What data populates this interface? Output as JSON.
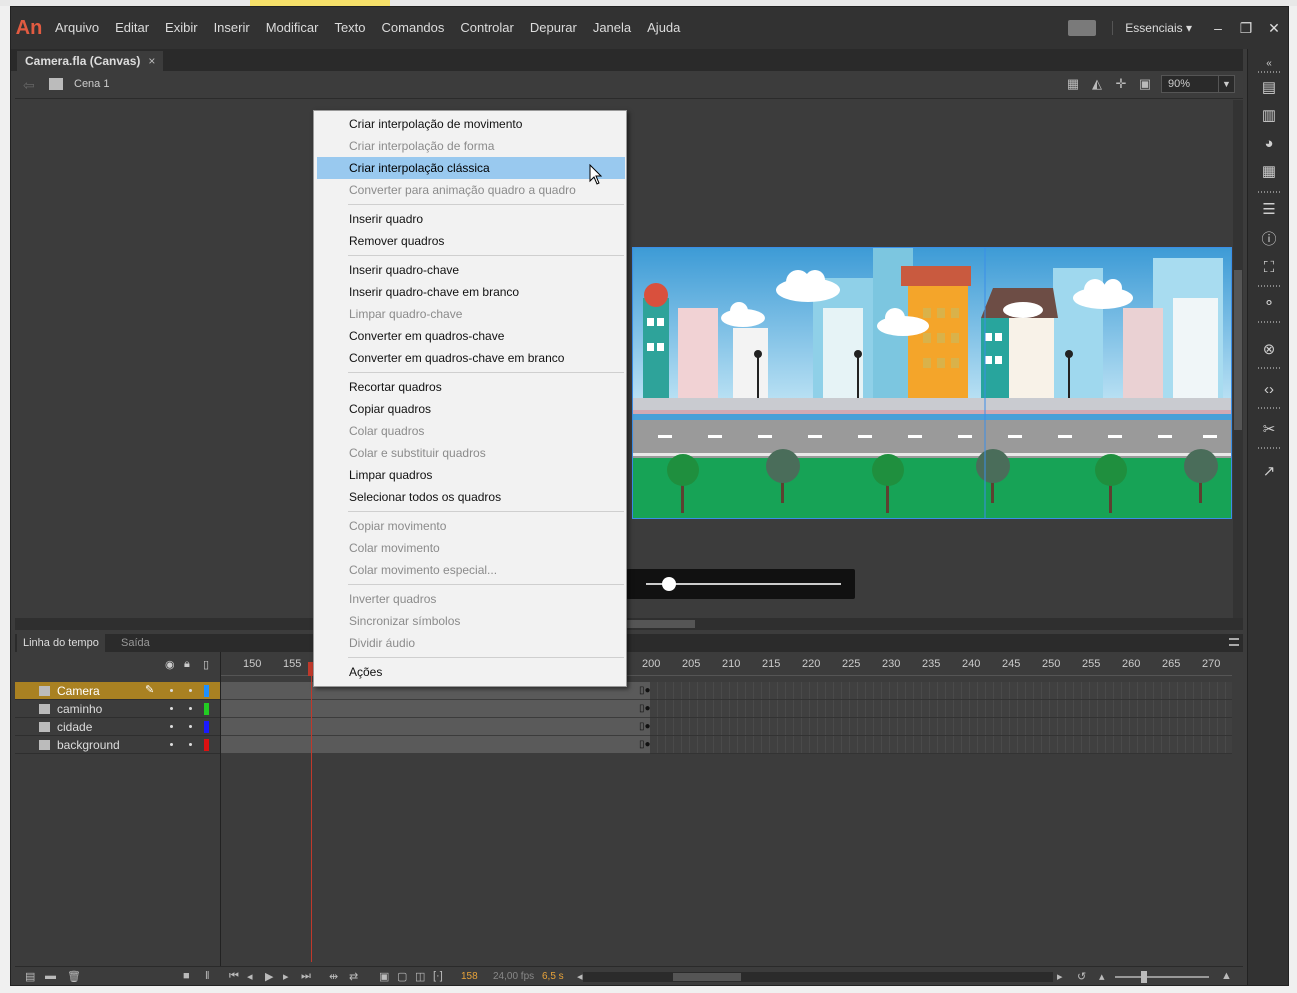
{
  "app": {
    "logo": "An",
    "menu": [
      "Arquivo",
      "Editar",
      "Exibir",
      "Inserir",
      "Modificar",
      "Texto",
      "Comandos",
      "Controlar",
      "Depurar",
      "Janela",
      "Ajuda"
    ],
    "workspace": "Essenciais",
    "window_controls": [
      "–",
      "❐",
      "✕"
    ]
  },
  "document": {
    "tab_title": "Camera.fla (Canvas)",
    "tab_close": "×",
    "scene_label": "Cena 1",
    "zoom": "90%"
  },
  "context_menu": {
    "items": [
      {
        "label": "Criar interpolação de movimento",
        "enabled": true
      },
      {
        "label": "Criar interpolação de forma",
        "enabled": false
      },
      {
        "label": "Criar interpolação clássica",
        "enabled": true,
        "highlighted": true
      },
      {
        "label": "Converter para animação quadro a quadro",
        "enabled": false
      },
      {
        "label": "Inserir quadro",
        "enabled": true
      },
      {
        "label": "Remover quadros",
        "enabled": true
      },
      {
        "label": "Inserir quadro-chave",
        "enabled": true
      },
      {
        "label": "Inserir quadro-chave em branco",
        "enabled": true
      },
      {
        "label": "Limpar quadro-chave",
        "enabled": false
      },
      {
        "label": "Converter em quadros-chave",
        "enabled": true
      },
      {
        "label": "Converter em quadros-chave em branco",
        "enabled": true
      },
      {
        "label": "Recortar quadros",
        "enabled": true
      },
      {
        "label": "Copiar quadros",
        "enabled": true
      },
      {
        "label": "Colar quadros",
        "enabled": false
      },
      {
        "label": "Colar e substituir quadros",
        "enabled": false
      },
      {
        "label": "Limpar quadros",
        "enabled": true
      },
      {
        "label": "Selecionar todos os quadros",
        "enabled": true
      },
      {
        "label": "Copiar movimento",
        "enabled": false
      },
      {
        "label": "Colar movimento",
        "enabled": false
      },
      {
        "label": "Colar movimento especial...",
        "enabled": false
      },
      {
        "label": "Inverter quadros",
        "enabled": false
      },
      {
        "label": "Sincronizar símbolos",
        "enabled": false
      },
      {
        "label": "Dividir áudio",
        "enabled": false
      },
      {
        "label": "Ações",
        "enabled": true
      }
    ]
  },
  "timeline": {
    "tabs": [
      "Linha do tempo",
      "Saída"
    ],
    "ruler": [
      "150",
      "155",
      "200",
      "205",
      "210",
      "215",
      "220",
      "225",
      "230",
      "235",
      "240",
      "245",
      "250",
      "255",
      "260",
      "265",
      "270"
    ],
    "layers": [
      {
        "name": "Camera",
        "color": "#1e90ff",
        "selected": true
      },
      {
        "name": "caminho",
        "color": "#22cc22",
        "selected": false
      },
      {
        "name": "cidade",
        "color": "#1a1aff",
        "selected": false
      },
      {
        "name": "background",
        "color": "#dd1111",
        "selected": false
      }
    ],
    "current_frame": "158",
    "fps": "24,00 fps",
    "time": "6,5 s"
  },
  "colors": {
    "accent_selection": "#a98122",
    "menu_highlight": "#99c9ef",
    "stage_border": "#3a8ee8",
    "logo": "#e25b41"
  }
}
